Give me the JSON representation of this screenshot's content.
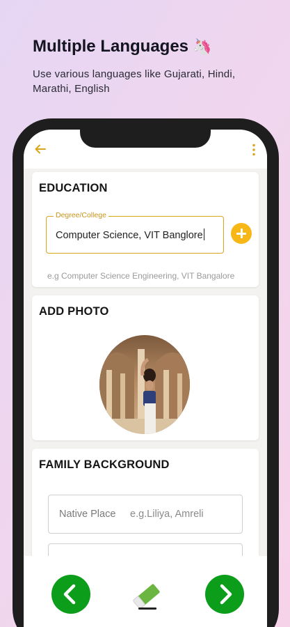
{
  "promo": {
    "title": "Multiple Languages",
    "title_icon": "unicorn-emoji",
    "subtitle": "Use various languages like Gujarati, Hindi, Marathi, English"
  },
  "appbar": {
    "back_icon": "arrow-left-icon",
    "menu_icon": "more-vertical-icon",
    "accent_color": "#d9a51a"
  },
  "education": {
    "title": "EDUCATION",
    "field_label": "Degree/College",
    "field_value": "Computer Science, VIT Banglore",
    "hint": "e.g Computer Science Engineering, VIT Bangalore",
    "add_icon": "plus-circle-icon"
  },
  "photo": {
    "title": "ADD PHOTO",
    "image": "profile-photo"
  },
  "family": {
    "title": "FAMILY BACKGROUND",
    "native_place_label": "Native Place",
    "native_place_placeholder": "e.g.Liliya, Amreli"
  },
  "bottom": {
    "prev_icon": "chevron-left-icon",
    "eraser_icon": "eraser-icon",
    "next_icon": "chevron-right-icon",
    "nav_color": "#0c9d1b"
  }
}
